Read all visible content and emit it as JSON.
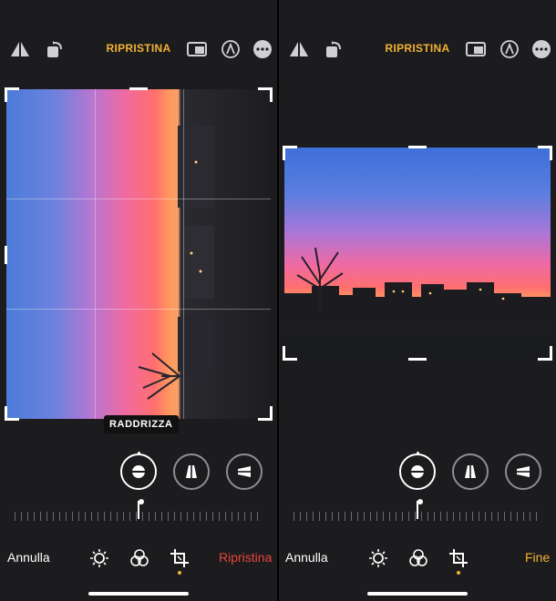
{
  "left": {
    "top_reset_label": "RIPRISTINA",
    "straighten_badge": "RADDRIZZA",
    "cancel_label": "Annulla",
    "done_label": "Ripristina",
    "done_color": "#e8443a"
  },
  "right": {
    "top_reset_label": "RIPRISTINA",
    "cancel_label": "Annulla",
    "done_label": "Fine",
    "done_color": "#f2b233"
  },
  "colors": {
    "accent": "#f2b233",
    "background": "#1c1c1e",
    "destructive": "#e8443a"
  },
  "icons": {
    "top": [
      "flip-icon",
      "rotate-icon",
      "aspect-ratio-icon",
      "markup-icon",
      "more-icon"
    ],
    "controls": [
      "straighten-icon",
      "vertical-perspective-icon",
      "horizontal-perspective-icon"
    ],
    "tools": [
      "adjust-icon",
      "filters-icon",
      "crop-icon"
    ]
  }
}
